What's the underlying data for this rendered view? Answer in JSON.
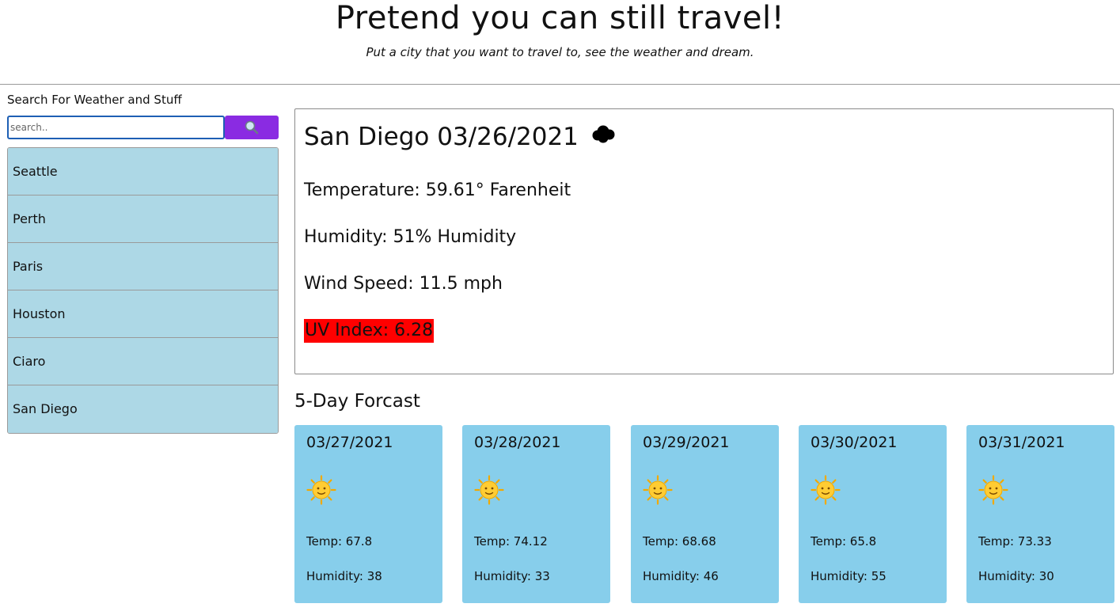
{
  "header": {
    "title": "Pretend you can still travel!",
    "subtitle": "Put a city that you want to travel to, see the weather and dream."
  },
  "search": {
    "label": "Search For Weather and Stuff",
    "placeholder": "search..",
    "value": "",
    "button_icon": "magnifying-glass-icon",
    "button_color": "#8a2be2"
  },
  "history": [
    {
      "city": "Seattle"
    },
    {
      "city": "Perth"
    },
    {
      "city": "Paris"
    },
    {
      "city": "Houston"
    },
    {
      "city": "Ciaro"
    },
    {
      "city": "San Diego"
    }
  ],
  "current": {
    "title": "San Diego 03/26/2021",
    "icon": "cloud-icon",
    "temperature": "Temperature: 59.61° Farenheit",
    "humidity": "Humidity: 51% Humidity",
    "wind": "Wind Speed: 11.5 mph",
    "uv": "UV Index: 6.28",
    "uv_color": "#ff0000"
  },
  "forecast": {
    "title": "5-Day Forcast",
    "card_color": "#87ceeb",
    "days": [
      {
        "date": "03/27/2021",
        "icon": "sun-icon",
        "temp": "Temp: 67.8",
        "humidity": "Humidity: 38"
      },
      {
        "date": "03/28/2021",
        "icon": "sun-icon",
        "temp": "Temp: 74.12",
        "humidity": "Humidity: 33"
      },
      {
        "date": "03/29/2021",
        "icon": "sun-icon",
        "temp": "Temp: 68.68",
        "humidity": "Humidity: 46"
      },
      {
        "date": "03/30/2021",
        "icon": "sun-icon",
        "temp": "Temp: 65.8",
        "humidity": "Humidity: 55"
      },
      {
        "date": "03/31/2021",
        "icon": "sun-icon",
        "temp": "Temp: 73.33",
        "humidity": "Humidity: 30"
      }
    ]
  }
}
